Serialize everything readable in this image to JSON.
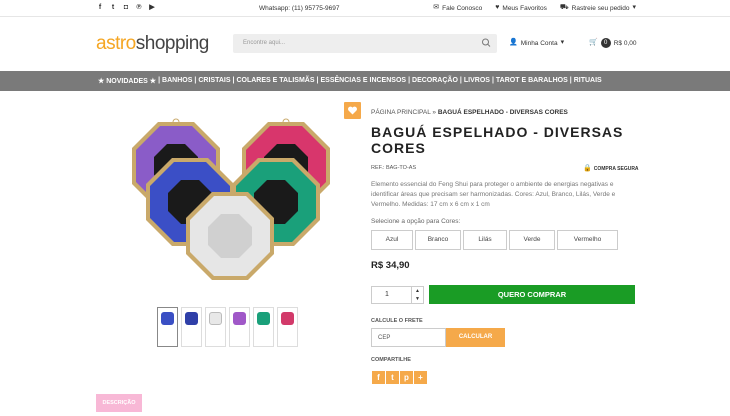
{
  "topbar": {
    "social": [
      "facebook-icon",
      "twitter-icon",
      "instagram-icon",
      "pinterest-icon",
      "youtube-icon"
    ],
    "whatsapp": "Whatsapp: (11) 95775-9697",
    "links": [
      {
        "icon": "mail-icon",
        "label": "Fale Conosco"
      },
      {
        "icon": "heart-icon",
        "label": "Meus Favoritos"
      },
      {
        "icon": "truck-icon",
        "label": "Rastreie seu pedido"
      }
    ]
  },
  "header": {
    "logo_a": "astro",
    "logo_b": "shopping",
    "search_placeholder": "Encontre aqui...",
    "account_label": "Minha Conta",
    "cart_count": "0",
    "cart_total": "R$ 0,00"
  },
  "nav": [
    "★ NOVIDADES ★",
    "BANHOS",
    "CRISTAIS",
    "COLARES E TALISMÃS",
    "ESSÊNCIAS E INCENSOS",
    "DECORAÇÃO",
    "LIVROS",
    "TAROT E BARALHOS",
    "RITUAIS"
  ],
  "product": {
    "breadcrumb_home": "PÁGINA PRINCIPAL",
    "breadcrumb_sep": "»",
    "breadcrumb_current": "BAGUÁ ESPELHADO - DIVERSAS CORES",
    "title": "BAGUÁ ESPELHADO - DIVERSAS CORES",
    "ref": "REF.: BAG-TO-AS",
    "secure": "COMPRA SEGURA",
    "description": "Elemento essencial do Feng Shui para proteger o ambiente de energias negativas e identificar áreas que precisam ser harmonizadas. Cores: Azul, Branco, Lilás, Verde e Vermelho. Medidas: 17 cm x 6 cm x 1 cm",
    "option_label": "Selecione a opção para Cores:",
    "options": [
      "Azul",
      "Branco",
      "Lilás",
      "Verde",
      "Vermelho"
    ],
    "price": "R$ 34,90",
    "quantity": "1",
    "buy_label": "QUERO COMPRAR",
    "frete_label": "CALCULE O FRETE",
    "cep_placeholder": "CEP",
    "calc_label": "CALCULAR",
    "share_label": "COMPARTILHE",
    "share_icons": [
      "f",
      "t",
      "p",
      "+"
    ],
    "description_tab": "DESCRIÇÃO"
  },
  "colors": {
    "accent": "#f5a94a",
    "buy": "#1a9c25",
    "nav": "#7a7a7a",
    "thumbs": [
      "#3a4fc4",
      "#2f3fa8",
      "#e8e8e8",
      "#a058c8",
      "#1aa07a",
      "#d23a6a"
    ]
  }
}
